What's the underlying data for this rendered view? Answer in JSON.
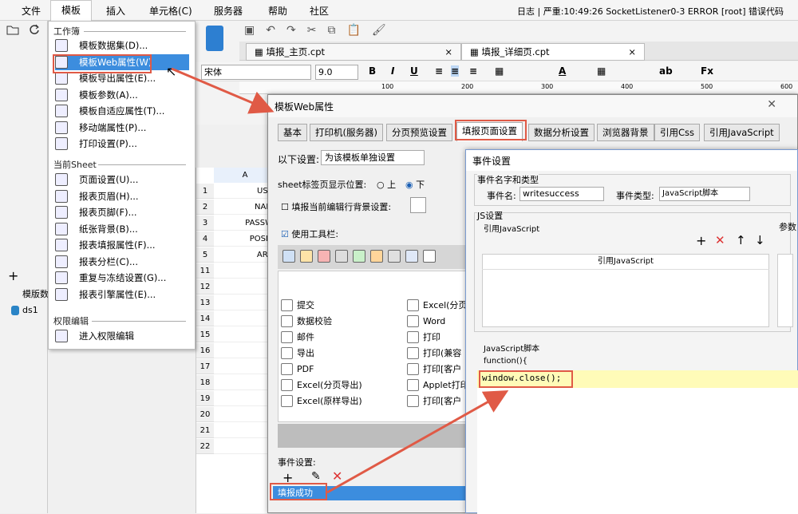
{
  "menu": {
    "file": "文件",
    "template": "模板",
    "insert": "插入",
    "cell": "单元格(C)",
    "server": "服务器",
    "help": "帮助",
    "community": "社区"
  },
  "log": "日志 | 严重:10:49:26 SocketListener0-3 ERROR [root] 错误代码",
  "tplmenu": {
    "sec_workbook": "工作簿",
    "items_wb": [
      {
        "label": "模板数据集(D)...",
        "icon": "database-icon"
      },
      {
        "label": "模板Web属性(W)",
        "icon": "globe-icon"
      },
      {
        "label": "模板导出属性(E)...",
        "icon": "export-icon"
      },
      {
        "label": "模板参数(A)...",
        "icon": "param-icon"
      },
      {
        "label": "模板自适应属性(T)...",
        "icon": "adapt-icon"
      },
      {
        "label": "移动端属性(P)...",
        "icon": "mobile-icon"
      },
      {
        "label": "打印设置(P)...",
        "icon": "printer-icon"
      }
    ],
    "sec_sheet": "当前Sheet",
    "items_sheet": [
      {
        "label": "页面设置(U)...",
        "icon": "page-icon"
      },
      {
        "label": "报表页眉(H)...",
        "icon": "header-icon"
      },
      {
        "label": "报表页脚(F)...",
        "icon": "footer-icon"
      },
      {
        "label": "纸张背景(B)...",
        "icon": "picture-icon"
      },
      {
        "label": "报表填报属性(F)...",
        "icon": "fill-icon"
      },
      {
        "label": "报表分栏(C)...",
        "icon": "column-icon"
      },
      {
        "label": "重复与冻结设置(G)...",
        "icon": "freeze-icon"
      },
      {
        "label": "报表引擎属性(E)...",
        "icon": "engine-icon"
      }
    ],
    "sec_perm": "权限编辑",
    "items_perm": [
      {
        "label": "进入权限编辑",
        "icon": "permission-icon"
      }
    ]
  },
  "tabs": [
    {
      "label": "填报_主页.cpt"
    },
    {
      "label": "填报_详细页.cpt"
    }
  ],
  "font": {
    "family": "宋体",
    "size": "9.0"
  },
  "ruler": [
    "100",
    "200",
    "300",
    "400",
    "500",
    "600"
  ],
  "tree": {
    "title": "模版数",
    "ds": "ds1"
  },
  "grid": {
    "colA": "A",
    "rows": [
      "1",
      "2",
      "3",
      "4",
      "5",
      "11",
      "12",
      "13",
      "14",
      "15",
      "16",
      "17",
      "18",
      "19",
      "20",
      "21",
      "22"
    ],
    "cells": [
      "USE",
      "NAM",
      "PASSW",
      "POSIT",
      "ARE"
    ]
  },
  "dlg1": {
    "title": "模板Web属性",
    "tabs": [
      "基本",
      "打印机(服务器)",
      "分页预览设置",
      "填报页面设置",
      "数据分析设置",
      "浏览器背景",
      "引用Css",
      "引用JavaScript"
    ],
    "set_label": "以下设置:",
    "set_value": "为该模板单独设置",
    "sheet_pos": "sheet标签页显示位置:",
    "opt_up": "上",
    "opt_down": "下",
    "fill_bg": "填报当前编辑行背景设置:",
    "use_toolbar": "使用工具栏:",
    "tools_left": [
      "提交",
      "数据校验",
      "邮件",
      "导出",
      "PDF",
      "Excel(分页导出)",
      "Excel(原样导出)"
    ],
    "tools_right": [
      "Excel(分页",
      "Word",
      "打印",
      "打印(兼容",
      "打印[客户",
      "Applet打印",
      "打印[客户"
    ],
    "event_label": "事件设置:",
    "event_item": "填报成功"
  },
  "dlg2": {
    "title": "事件设置",
    "grp_name": "事件名字和类型",
    "name_label": "事件名:",
    "name_value": "writesuccess",
    "type_label": "事件类型:",
    "type_value": "JavaScript脚本",
    "js_settings": "JS设置",
    "ref_js": "引用JavaScript",
    "col_header": "引用JavaScript",
    "param": "参数",
    "script_label": "JavaScript脚本",
    "func": "function(){",
    "code": "window.close();"
  }
}
